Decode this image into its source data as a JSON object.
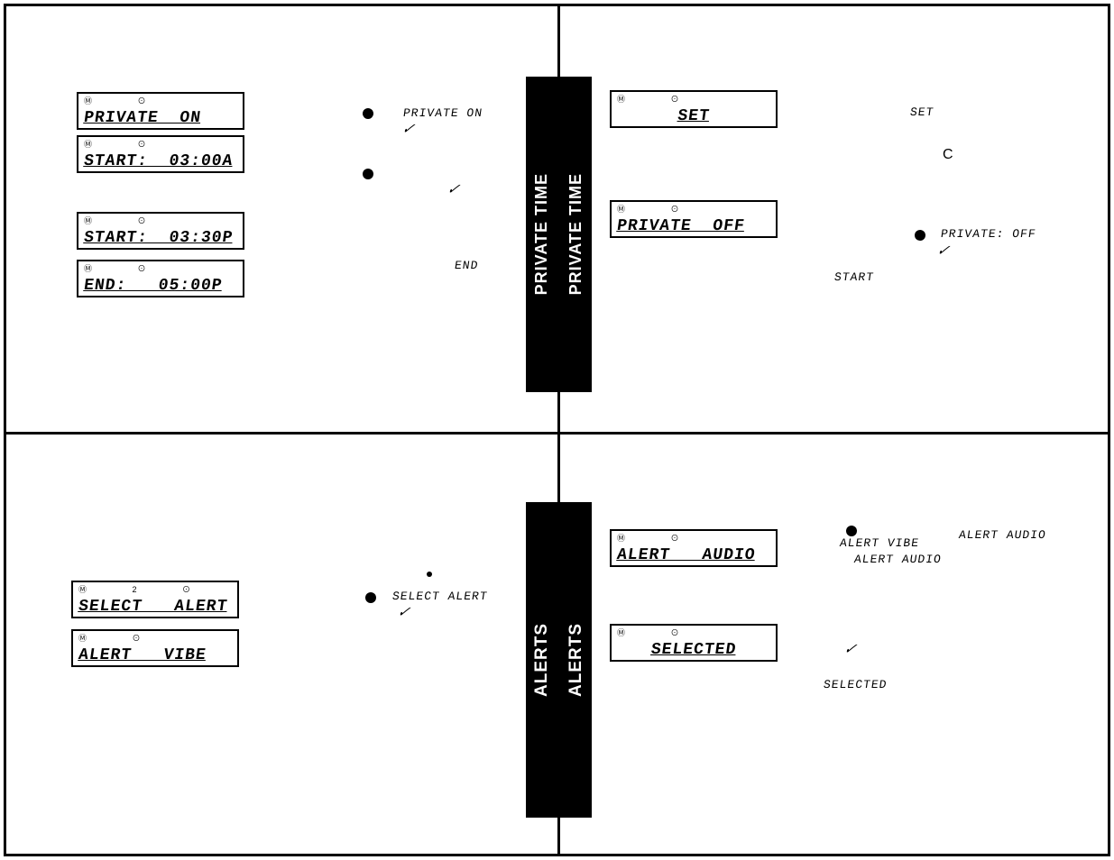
{
  "sections": {
    "privateTime": "PRIVATE TIME",
    "alerts": "ALERTS"
  },
  "q1": {
    "lcd1": "PRIVATE  ON",
    "lcd2": "START:  03:00A",
    "lcd3": "START:  03:30P",
    "lcd4": "END:   05:00P",
    "note1": "PRIVATE ON",
    "note2": "END"
  },
  "q2": {
    "lcd1": "SET",
    "lcd2": "PRIVATE  OFF",
    "note1": "SET",
    "note2": "PRIVATE: OFF",
    "note3": "START",
    "noteC": "C"
  },
  "q3": {
    "lcd1": "SELECT   ALERT",
    "lcd2": "ALERT   VIBE",
    "note1": "SELECT ALERT"
  },
  "q4": {
    "lcd1": "ALERT   AUDIO",
    "lcd2": "SELECTED",
    "note1": "ALERT VIBE",
    "note2": "ALERT AUDIO",
    "note3": "ALERT AUDIO",
    "note4": "SELECTED"
  },
  "icons": {
    "pair": "Ⓜ  ⊙",
    "pair2": "Ⓜ 2 ⊙"
  }
}
